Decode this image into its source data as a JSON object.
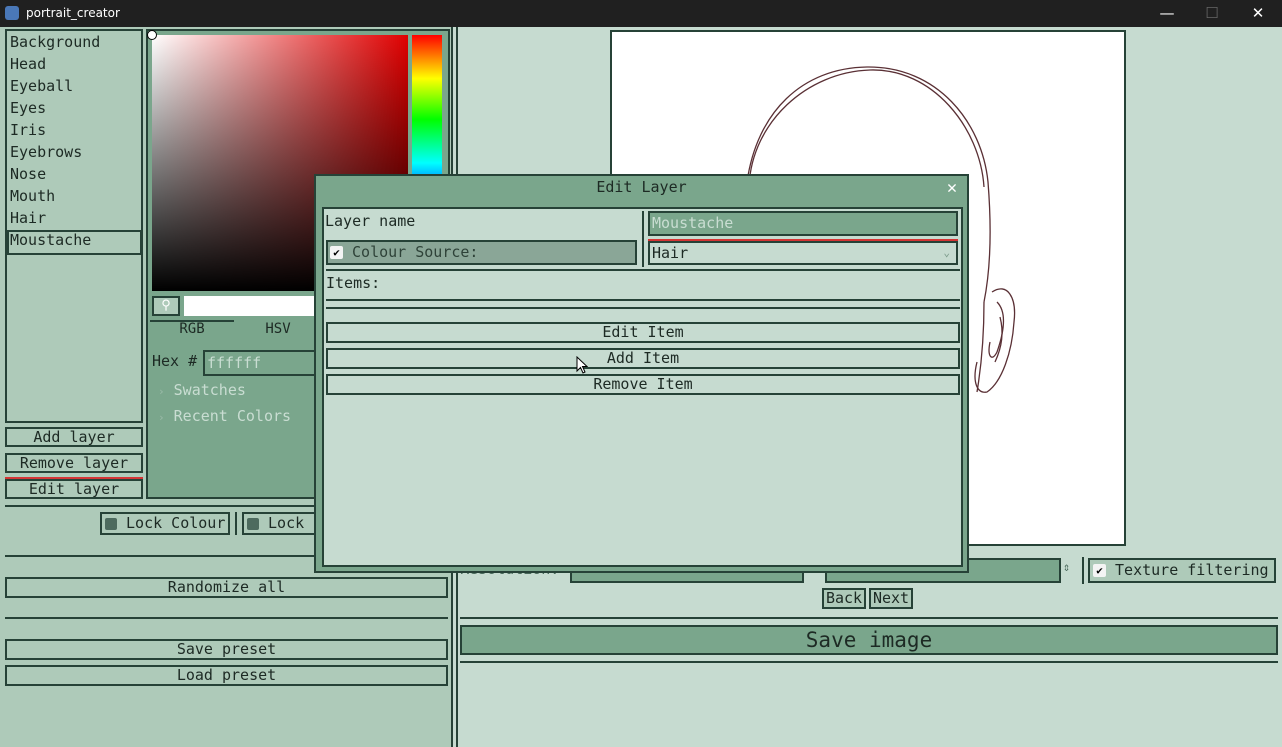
{
  "window": {
    "title": "portrait_creator",
    "minimize_glyph": "—",
    "maximize_glyph": "☐",
    "close_glyph": "✕"
  },
  "layers": {
    "items": [
      "Background",
      "Head",
      "Eyeball",
      "Eyes",
      "Iris",
      "Eyebrows",
      "Nose",
      "Mouth",
      "Hair",
      "Moustache"
    ],
    "selected": "Moustache",
    "add_label": "Add layer",
    "remove_label": "Remove layer",
    "edit_label": "Edit layer"
  },
  "locks": {
    "lock_colour": "Lock Colour",
    "lock_item": "Lock I"
  },
  "actions": {
    "randomize_all": "Randomize all",
    "save_preset": "Save preset",
    "load_preset": "Load preset"
  },
  "color_picker": {
    "tab_rgb": "RGB",
    "tab_hsv": "HSV",
    "hex_label": "Hex #",
    "hex_value": "ffffff",
    "swatches": "Swatches",
    "recent_colors": "Recent Colors"
  },
  "render": {
    "resolution_label": "Resolution:",
    "texture_filtering": "Texture filtering",
    "back": "Back",
    "next": "Next",
    "save_image": "Save image"
  },
  "dialog": {
    "title": "Edit Layer",
    "layer_name_label": "Layer name",
    "layer_name_value": "Moustache",
    "colour_source_label": "Colour Source:",
    "colour_source_value": "Hair",
    "items_label": "Items:",
    "edit_item": "Edit Item",
    "add_item": "Add Item",
    "remove_item": "Remove Item",
    "close_glyph": "✕"
  },
  "colors": {
    "accent": "#d43434",
    "panel": "#aecab9",
    "field": "#7aa68c",
    "border": "#264237"
  }
}
